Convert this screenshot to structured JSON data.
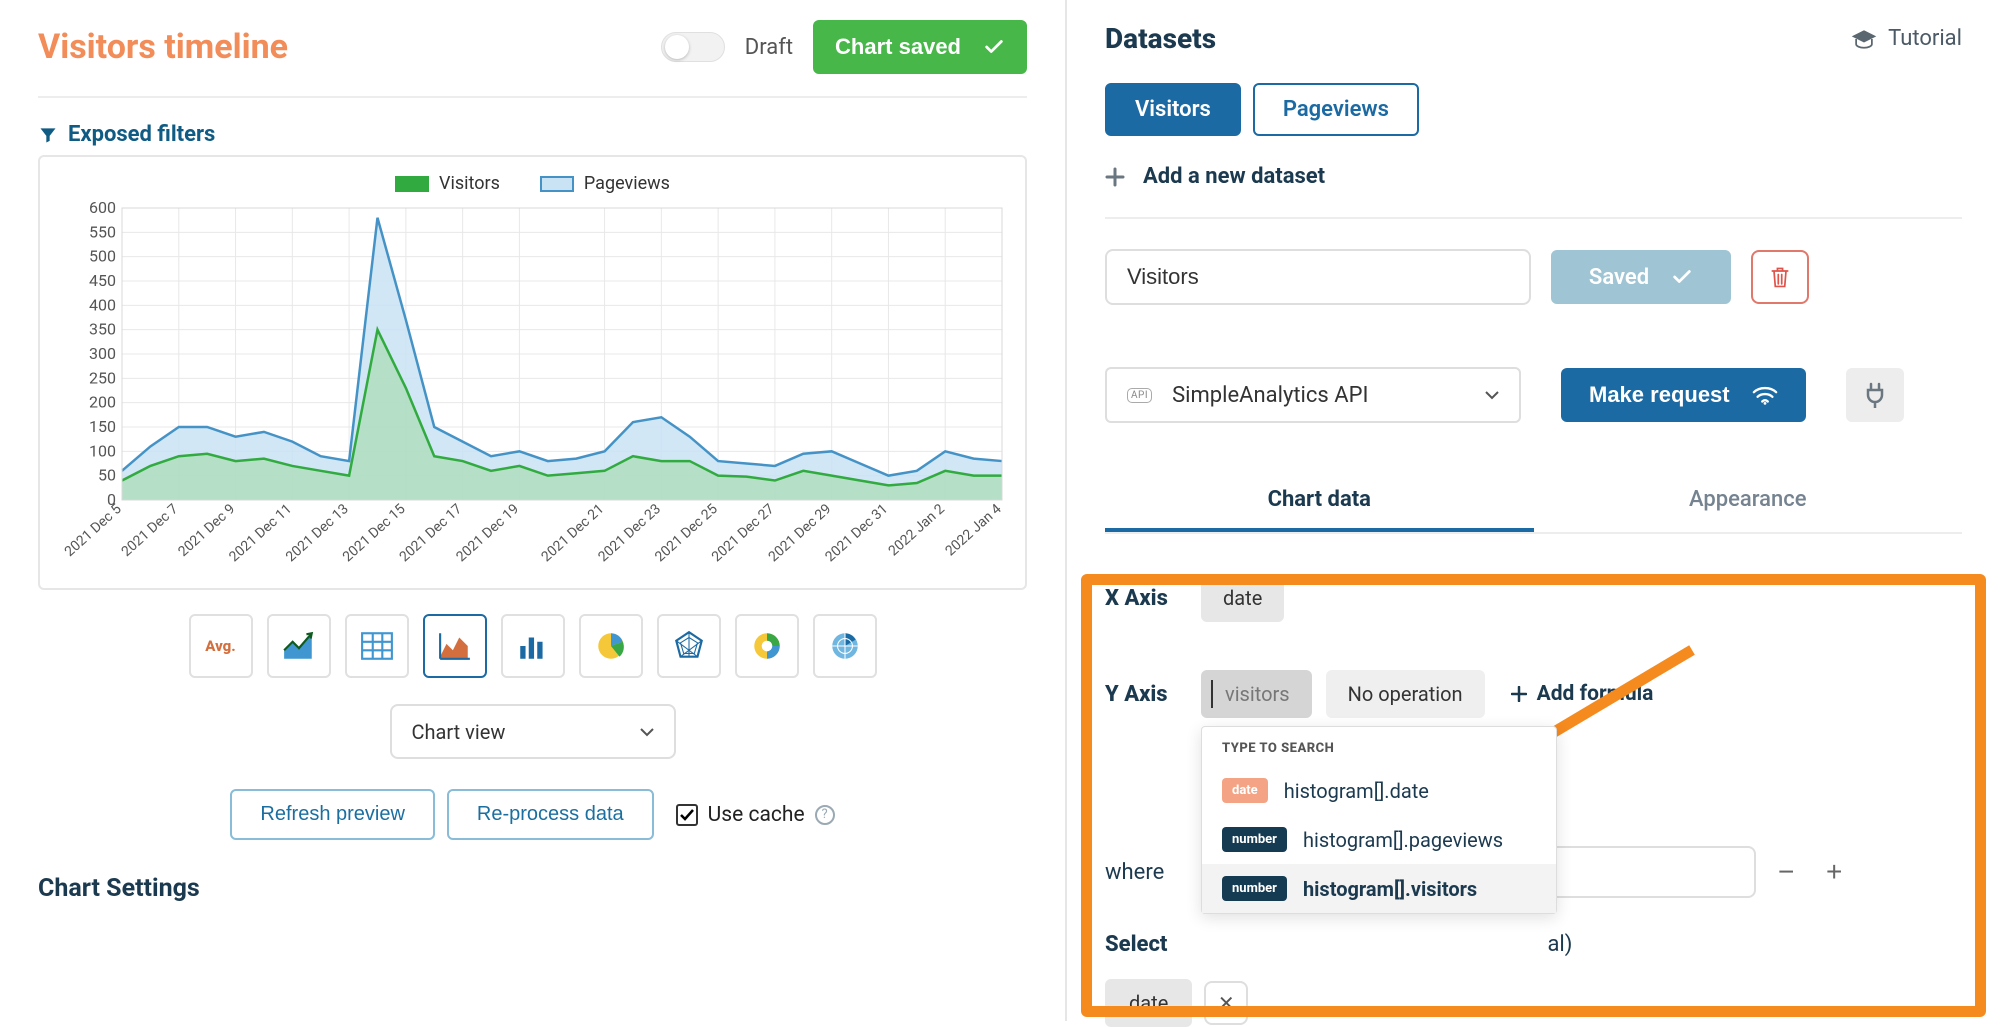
{
  "header": {
    "title": "Visitors timeline",
    "draft_label": "Draft",
    "chart_saved_label": "Chart saved"
  },
  "exposed_filters_label": "Exposed filters",
  "chart_data": {
    "type": "line",
    "categories": [
      "2021 Dec 5",
      "2021 Dec 7",
      "2021 Dec 9",
      "2021 Dec 11",
      "2021 Dec 13",
      "2021 Dec 15",
      "2021 Dec 17",
      "2021 Dec 19",
      "2021 Dec 21",
      "2021 Dec 23",
      "2021 Dec 25",
      "2021 Dec 27",
      "2021 Dec 29",
      "2021 Dec 31",
      "2022 Jan 2",
      "2022 Jan 4"
    ],
    "series": [
      {
        "name": "Visitors",
        "color": "#31ab3f",
        "fill": "#9ed9a1",
        "values_at_labels": [
          40,
          90,
          80,
          70,
          50,
          350,
          90,
          60,
          50,
          60,
          80,
          50,
          40,
          50,
          30,
          60,
          50
        ],
        "values_full": [
          40,
          70,
          90,
          95,
          80,
          85,
          70,
          60,
          50,
          350,
          230,
          90,
          80,
          60,
          70,
          50,
          55,
          60,
          90,
          80,
          80,
          50,
          48,
          40,
          60,
          50,
          40,
          30,
          35,
          60,
          50,
          50
        ]
      },
      {
        "name": "Pageviews",
        "color": "#4593c6",
        "fill": "#c9e3f5",
        "values_at_labels": [
          60,
          150,
          130,
          120,
          80,
          580,
          150,
          90,
          80,
          100,
          170,
          80,
          70,
          100,
          50,
          100,
          80
        ],
        "values_full": [
          60,
          110,
          150,
          150,
          130,
          140,
          120,
          90,
          80,
          580,
          370,
          150,
          120,
          90,
          100,
          80,
          85,
          100,
          160,
          170,
          130,
          80,
          75,
          70,
          95,
          100,
          75,
          50,
          60,
          100,
          85,
          80
        ]
      }
    ],
    "ylim": [
      0,
      600
    ],
    "yticks": [
      0,
      50,
      100,
      150,
      200,
      250,
      300,
      350,
      400,
      450,
      500,
      550,
      600
    ],
    "xlabel": "",
    "ylabel": "",
    "title": ""
  },
  "chart_legend": {
    "visitors": "Visitors",
    "pageviews": "Pageviews"
  },
  "chart_view": {
    "label": "Chart view"
  },
  "actions": {
    "refresh": "Refresh preview",
    "reprocess": "Re-process data",
    "use_cache": "Use cache"
  },
  "chart_settings_heading": "Chart Settings",
  "right": {
    "datasets_title": "Datasets",
    "tutorial_label": "Tutorial",
    "tabs": [
      "Visitors",
      "Pageviews"
    ],
    "add_dataset_label": "Add a new dataset",
    "dataset_name_value": "Visitors",
    "saved_label": "Saved",
    "api_select_label": "SimpleAnalytics API",
    "make_request_label": "Make request",
    "subtabs": {
      "chart_data": "Chart data",
      "appearance": "Appearance"
    },
    "x_axis": {
      "label": "X Axis",
      "chip": "date"
    },
    "y_axis": {
      "label": "Y Axis",
      "chip_placeholder": "visitors",
      "no_op": "No operation",
      "add_formula": "Add formula"
    },
    "dropdown": {
      "header": "TYPE TO SEARCH",
      "items": [
        {
          "type": "date",
          "label": "histogram[].date"
        },
        {
          "type": "number",
          "label": "histogram[].pageviews"
        },
        {
          "type": "number",
          "label": "histogram[].visitors",
          "selected": true
        }
      ]
    },
    "where_label": "where",
    "select_label": "Select",
    "select_tail": "al)",
    "date_chip": "date"
  },
  "chart_type_icons": [
    "avg",
    "area",
    "table",
    "area2",
    "bar",
    "pie",
    "radar",
    "donut",
    "polar"
  ]
}
